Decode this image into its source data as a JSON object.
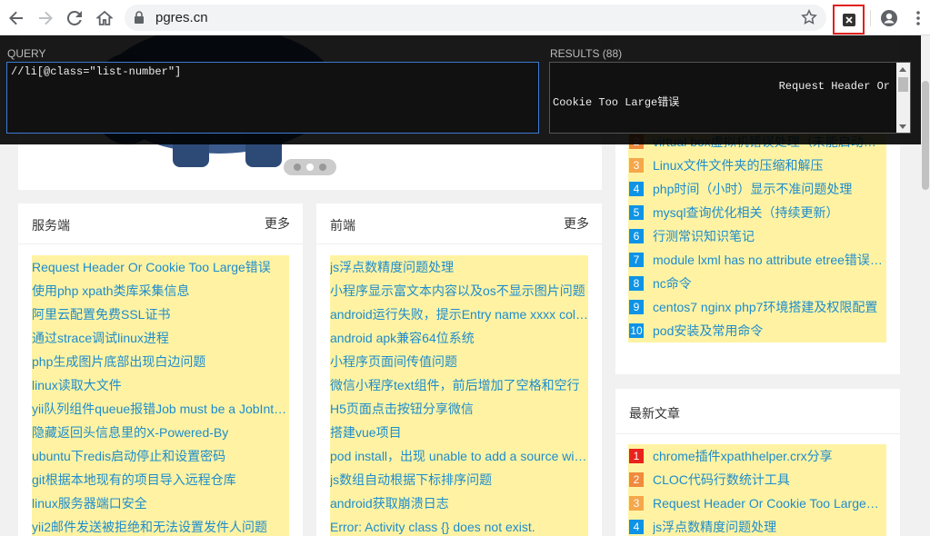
{
  "browser": {
    "url": "pgres.cn"
  },
  "overlay": {
    "query_label": "QUERY",
    "query_value": "//li[@class=\"list-number\"]",
    "results_label": "RESULTS (88)",
    "results_line1": "Request Header Or",
    "results_line2": "Cookie Too Large错误"
  },
  "server_card": {
    "title": "服务端",
    "more": "更多",
    "items": [
      "Request Header Or Cookie Too Large错误",
      "使用php xpath类库采集信息",
      "阿里云配置免费SSL证书",
      "通过strace调试linux进程",
      "php生成图片底部出现白边问题",
      "linux读取大文件",
      "yii队列组件queue报错Job must be a JobInterface instance",
      "隐藏返回头信息里的X-Powered-By",
      "ubuntu下redis启动停止和设置密码",
      "git根据本地现有的项目导入远程仓库",
      "linux服务器端口安全",
      "yii2邮件发送被拒绝和无法设置发件人问题"
    ]
  },
  "frontend_card": {
    "title": "前端",
    "more": "更多",
    "items": [
      "js浮点数精度问题处理",
      "小程序显示富文本内容以及os不显示图片问题",
      "android运行失败，提示Entry name xxxx collided",
      "android apk兼容64位系统",
      "小程序页面间传值问题",
      "微信小程序text组件，前后增加了空格和空行",
      "H5页面点击按钮分享微信",
      "搭建vue项目",
      "pod install，出现 unable to add a source with url",
      "js数组自动根据下标排序问题",
      "android获取崩溃日志",
      "Error: Activity class {} does not exist."
    ]
  },
  "hot_list": {
    "items": [
      {
        "num": "2",
        "text": "virtual box虚拟机错误处理（未能启动虚拟电脑）",
        "color": "#f08a3c"
      },
      {
        "num": "3",
        "text": "Linux文件文件夹的压缩和解压",
        "color": "#f5a74a"
      },
      {
        "num": "4",
        "text": "php时间（小时）显示不准问题处理",
        "color": "#0e93e6"
      },
      {
        "num": "5",
        "text": "mysql查询优化相关（持续更新）",
        "color": "#0e93e6"
      },
      {
        "num": "6",
        "text": "行测常识知识笔记",
        "color": "#0e93e6"
      },
      {
        "num": "7",
        "text": " module lxml has no attribute etree错误处理",
        "color": "#0e93e6"
      },
      {
        "num": "8",
        "text": "nc命令",
        "color": "#0e93e6"
      },
      {
        "num": "9",
        "text": "centos7 nginx php7环境搭建及权限配置",
        "color": "#0e93e6"
      },
      {
        "num": "10",
        "text": "pod安装及常用命令",
        "color": "#0e93e6"
      }
    ]
  },
  "latest_card": {
    "title": "最新文章",
    "items": [
      {
        "num": "1",
        "text": "chrome插件xpathhelper.crx分享",
        "color": "#e8231c"
      },
      {
        "num": "2",
        "text": "CLOC代码行数统计工具",
        "color": "#f08a3c"
      },
      {
        "num": "3",
        "text": "Request Header Or Cookie Too Large错误",
        "color": "#f5a74a"
      },
      {
        "num": "4",
        "text": "js浮点数精度问题处理",
        "color": "#0e93e6"
      }
    ]
  },
  "colors": {
    "link": "#1e8ccc",
    "highlight": "#fff3a3",
    "ext_border": "#e0211f"
  }
}
